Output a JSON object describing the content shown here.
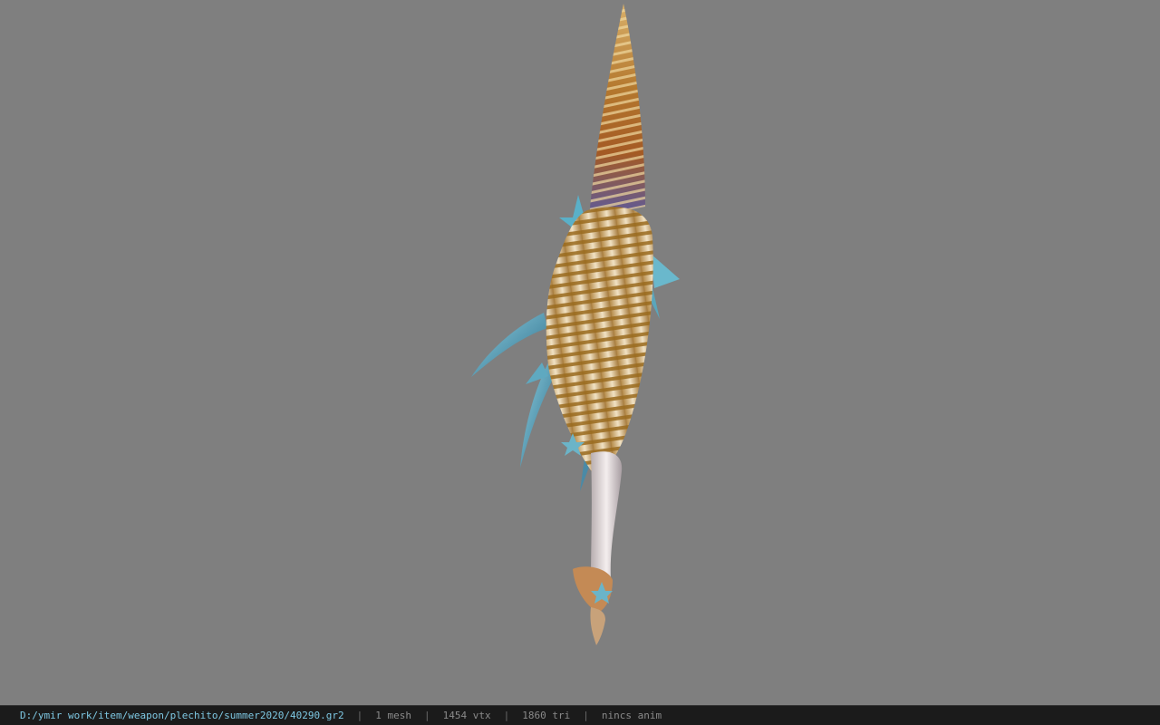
{
  "viewer": {
    "background_color": "#7f7f7f",
    "model_name": "shell-spear-weapon"
  },
  "statusbar": {
    "file_path": "D:/ymir work/item/weapon/plechito/summer2020/40290.gr2",
    "separator": "|",
    "mesh_count": "1 mesh",
    "vertex_count": "1454 vtx",
    "triangle_count": "1860 tri",
    "anim_status": "nincs anim",
    "path_color": "#7ec8e3"
  }
}
